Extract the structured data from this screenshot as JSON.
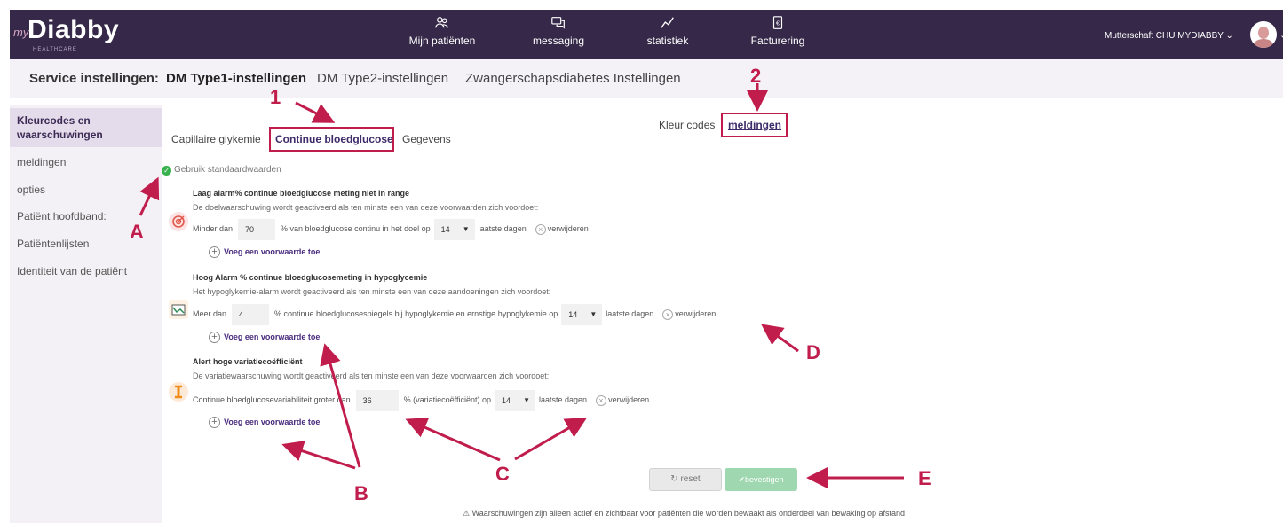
{
  "logo": {
    "prefix": "my",
    "name": "Diabby",
    "subtitle": "HEALTHCARE"
  },
  "nav": [
    {
      "label": "Mijn patiënten",
      "icon": "patients-icon"
    },
    {
      "label": "messaging",
      "icon": "chat-icon"
    },
    {
      "label": "statistiek",
      "icon": "stats-icon"
    },
    {
      "label": "Facturering",
      "icon": "invoice-icon"
    }
  ],
  "user": {
    "name": "Mutterschaft CHU MYDIABBY"
  },
  "subheader": {
    "label": "Service instellingen:",
    "tabs": [
      "DM Type1-instellingen",
      "DM Type2-instellingen",
      "Zwangerschapsdiabetes Instellingen"
    ],
    "active_tab": 0
  },
  "sidebar": {
    "items": [
      "Kleurcodes en waarschuwingen",
      "meldingen",
      "opties",
      "Patiënt hoofdband:",
      "Patiëntenlijsten",
      "Identiteit van de patiënt"
    ]
  },
  "content_tabs": [
    "Capillaire glykemie",
    "Continue bloedglucose",
    "Gegevens"
  ],
  "right_tabs": [
    "Kleur codes",
    "meldingen"
  ],
  "default_check": "Gebruik standaardwaarden",
  "sections": [
    {
      "title": "Laag alarm% continue bloedglucose meting niet in range",
      "desc": "De doelwaarschuwing wordt geactiveerd als ten minste een van deze voorwaarden zich voordoet:",
      "pre": "Minder dan",
      "value": "70",
      "mid": "% van bloedglucose continu in het doel op",
      "days": "14",
      "post": "laatste dagen",
      "remove": "verwijderen",
      "add": "Voeg een voorwaarde toe"
    },
    {
      "title": "Hoog Alarm % continue bloedglucosemeting in hypoglycemie",
      "desc": "Het hypoglykemie-alarm wordt geactiveerd als ten minste een van deze aandoeningen zich voordoet:",
      "pre": "Meer dan",
      "value": "4",
      "mid": "% continue bloedglucosespiegels bij hypoglykemie en ernstige hypoglykemie op",
      "days": "14",
      "post": "laatste dagen",
      "remove": "verwijderen",
      "add": "Voeg een voorwaarde toe"
    },
    {
      "title": "Alert hoge variatiecoëfficiënt",
      "desc": "De variatiewaarschuwing wordt geactiveerd als ten minste een van deze voorwaarden zich voordoet:",
      "pre": "Continue bloedglucosevariabiliteit groter dan",
      "value": "36",
      "mid": "% (variatiecoëfficiënt) op",
      "days": "14",
      "post": "laatste dagen",
      "remove": "verwijderen",
      "add": "Voeg een voorwaarde toe"
    }
  ],
  "buttons": {
    "reset": "reset",
    "confirm": "bevestigen"
  },
  "footer_warning": "Waarschuwingen zijn alleen actief en zichtbaar voor patiënten die worden bewaakt als onderdeel van bewaking op afstand",
  "annotations": [
    "1",
    "2",
    "A",
    "B",
    "C",
    "D",
    "E"
  ],
  "colors": {
    "topbar": "#352848",
    "annotation": "#c01c4c",
    "accent": "#4b2d7f",
    "success": "#37b24d"
  }
}
